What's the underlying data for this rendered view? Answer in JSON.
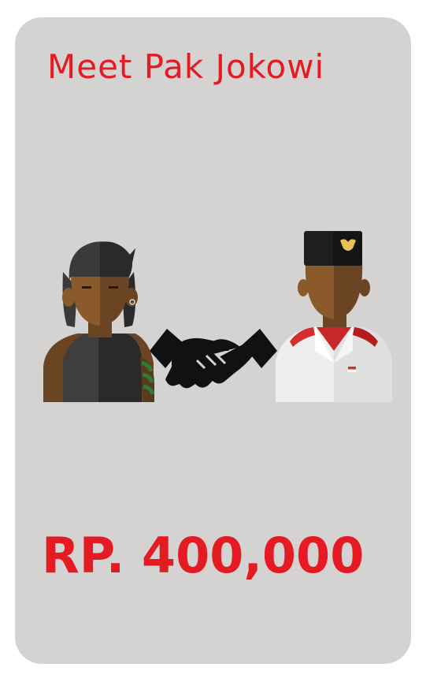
{
  "card": {
    "title": "Meet Pak Jokowi",
    "price": "RP. 400,000",
    "colors": {
      "background": "#d5d2d2",
      "accent": "#e51b23"
    }
  },
  "illustration": {
    "left_figure": "rocker-avatar",
    "center_icon": "handshake-icon",
    "right_figure": "official-avatar"
  }
}
